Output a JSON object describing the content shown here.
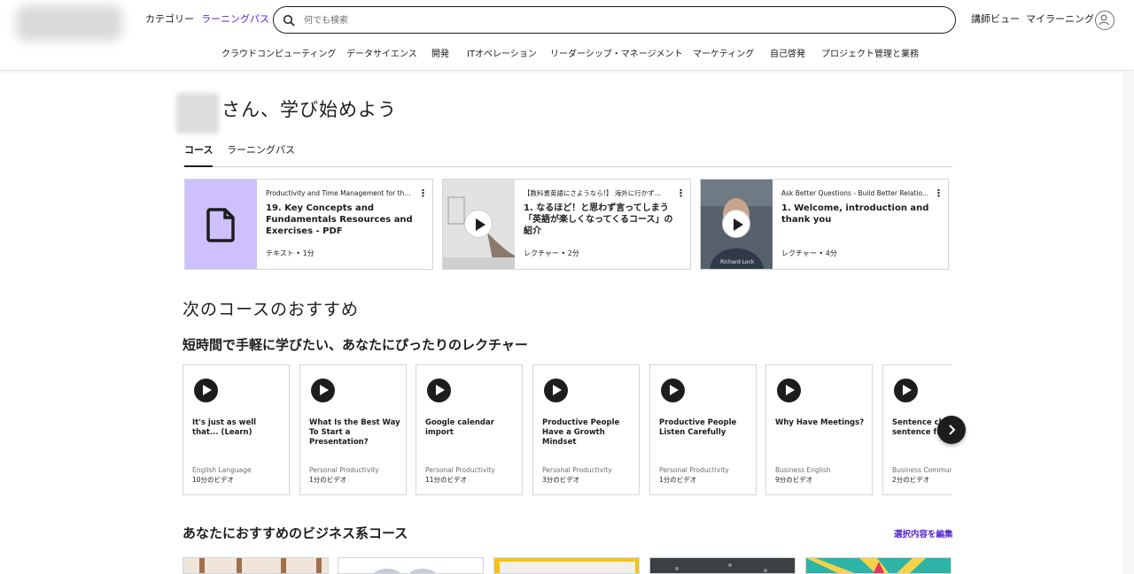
{
  "header": {
    "nav": {
      "categories": "カテゴリー",
      "learning_paths": "ラーニングパス"
    },
    "search_placeholder": "何でも検索",
    "right": {
      "instructor_view": "講師ビュー",
      "my_learning": "マイラーニング"
    }
  },
  "subnav": [
    "クラウドコンピューティング",
    "データサイエンス",
    "開発",
    "ITオペレーション",
    "リーダーシップ・マネージメント",
    "マーケティング",
    "自己啓発",
    "プロジェクト管理と業務"
  ],
  "greeting": "さん、学び始めよう",
  "tabs": [
    "コース",
    "ラーニングパス"
  ],
  "continue_cards": [
    {
      "course": "Productivity and Time Management for the...",
      "title": "19. Key Concepts and Fundamentals Resources and Exercises - PDF",
      "meta": "テキスト • 1分"
    },
    {
      "course": "【教科書英語にさようなら!】 海外に行かず...",
      "title": "1. なるほど！と思わず言ってしまう「英語が楽しくなってくるコース」の紹介",
      "meta": "レクチャー • 2分"
    },
    {
      "course": "Ask Better Questions - Build Better Relatio...",
      "title": "1. Welcome, introduction and thank you",
      "meta": "レクチャー • 4分"
    }
  ],
  "sections": {
    "next_courses": "次のコースのおすすめ",
    "short_lectures": "短時間で手軽に学びたい、あなたにぴったりのレクチャー",
    "business_courses": "あなたにおすすめのビジネス系コース",
    "edit_selection": "選択内容を編集"
  },
  "lectures": [
    {
      "title": "It's just as well that... (Learn)",
      "category": "English Language",
      "duration": "10分のビデオ"
    },
    {
      "title": "What Is the Best Way To Start a Presentation?",
      "category": "Personal Productivity",
      "duration": "1分のビデオ"
    },
    {
      "title": "Google calendar import",
      "category": "Personal Productivity",
      "duration": "11分のビデオ"
    },
    {
      "title": "Productive People Have a Growth Mindset",
      "category": "Personal Productivity",
      "duration": "3分のビデオ"
    },
    {
      "title": "Productive People Listen Carefully",
      "category": "Personal Productivity",
      "duration": "1分のビデオ"
    },
    {
      "title": "Why Have Meetings?",
      "category": "Business English",
      "duration": "9分のビデオ"
    },
    {
      "title": "Sentence cla... sentence fra...",
      "category": "Business Commun...",
      "duration": "2分のビデオ"
    }
  ],
  "thumb_labels": {
    "richard": "Richard Lock"
  },
  "colors": {
    "accent": "#5624d0",
    "text": "#1c1d1f",
    "doc_bg": "#cec0fc"
  }
}
